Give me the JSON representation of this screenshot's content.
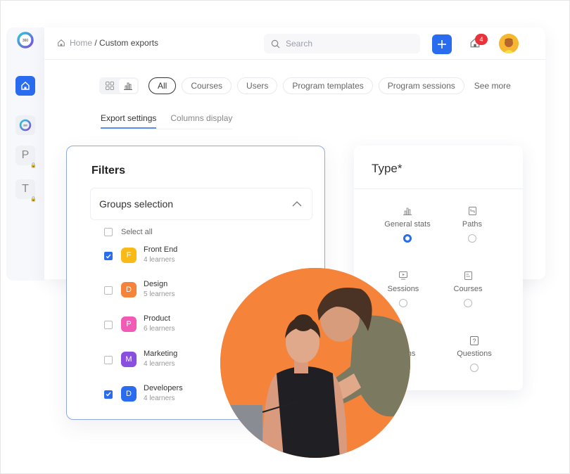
{
  "breadcrumb": {
    "home": "Home",
    "separator": " / ",
    "current": "Custom exports"
  },
  "search": {
    "placeholder": "Search"
  },
  "notifications": {
    "count": "4"
  },
  "logo": {
    "text": "360"
  },
  "sidebar": {
    "items": [
      {
        "icon": "home-icon",
        "active": true
      },
      {
        "icon": "360-logo-icon",
        "active": false
      },
      {
        "letter": "P",
        "locked": true
      },
      {
        "letter": "T",
        "locked": true
      }
    ]
  },
  "filter_chips": [
    {
      "label": "All",
      "active": true
    },
    {
      "label": "Courses",
      "active": false
    },
    {
      "label": "Users",
      "active": false
    },
    {
      "label": "Program templates",
      "active": false
    },
    {
      "label": "Program sessions",
      "active": false
    }
  ],
  "see_more": "See more",
  "tabs": [
    {
      "label": "Export settings",
      "active": true
    },
    {
      "label": "Columns display",
      "active": false
    }
  ],
  "filters": {
    "title": "Filters",
    "groups_title": "Groups selection",
    "select_all": "Select all",
    "groups": [
      {
        "initial": "F",
        "name": "Front End",
        "count": "4 learners",
        "checked": true,
        "color": "#f9b916"
      },
      {
        "initial": "D",
        "name": "Design",
        "count": "5 learners",
        "checked": false,
        "color": "#f5843a"
      },
      {
        "initial": "P",
        "name": "Product",
        "count": "6 learners",
        "checked": false,
        "color": "#f15bb5"
      },
      {
        "initial": "M",
        "name": "Marketing",
        "count": "4 learners",
        "checked": false,
        "color": "#8a4fe0"
      },
      {
        "initial": "D",
        "name": "Developers",
        "count": "4 learners",
        "checked": true,
        "color": "#2a6cf0"
      }
    ]
  },
  "type": {
    "title": "Type*",
    "options": [
      {
        "label": "General stats",
        "icon": "bar-chart-icon",
        "selected": true
      },
      {
        "label": "Paths",
        "icon": "path-doc-icon",
        "selected": false
      },
      {
        "label": "Sessions",
        "icon": "screen-icon",
        "selected": false
      },
      {
        "label": "Courses",
        "icon": "course-doc-icon",
        "selected": false
      },
      {
        "label": "Rooms",
        "icon": "room-icon",
        "selected": false
      },
      {
        "label": "Questions",
        "icon": "question-icon",
        "selected": false
      }
    ]
  },
  "colors": {
    "accent": "#2a6cf0",
    "photo_bg": "#f5843a",
    "badge": "#e8333a",
    "avatar_bg": "#f7b731"
  }
}
